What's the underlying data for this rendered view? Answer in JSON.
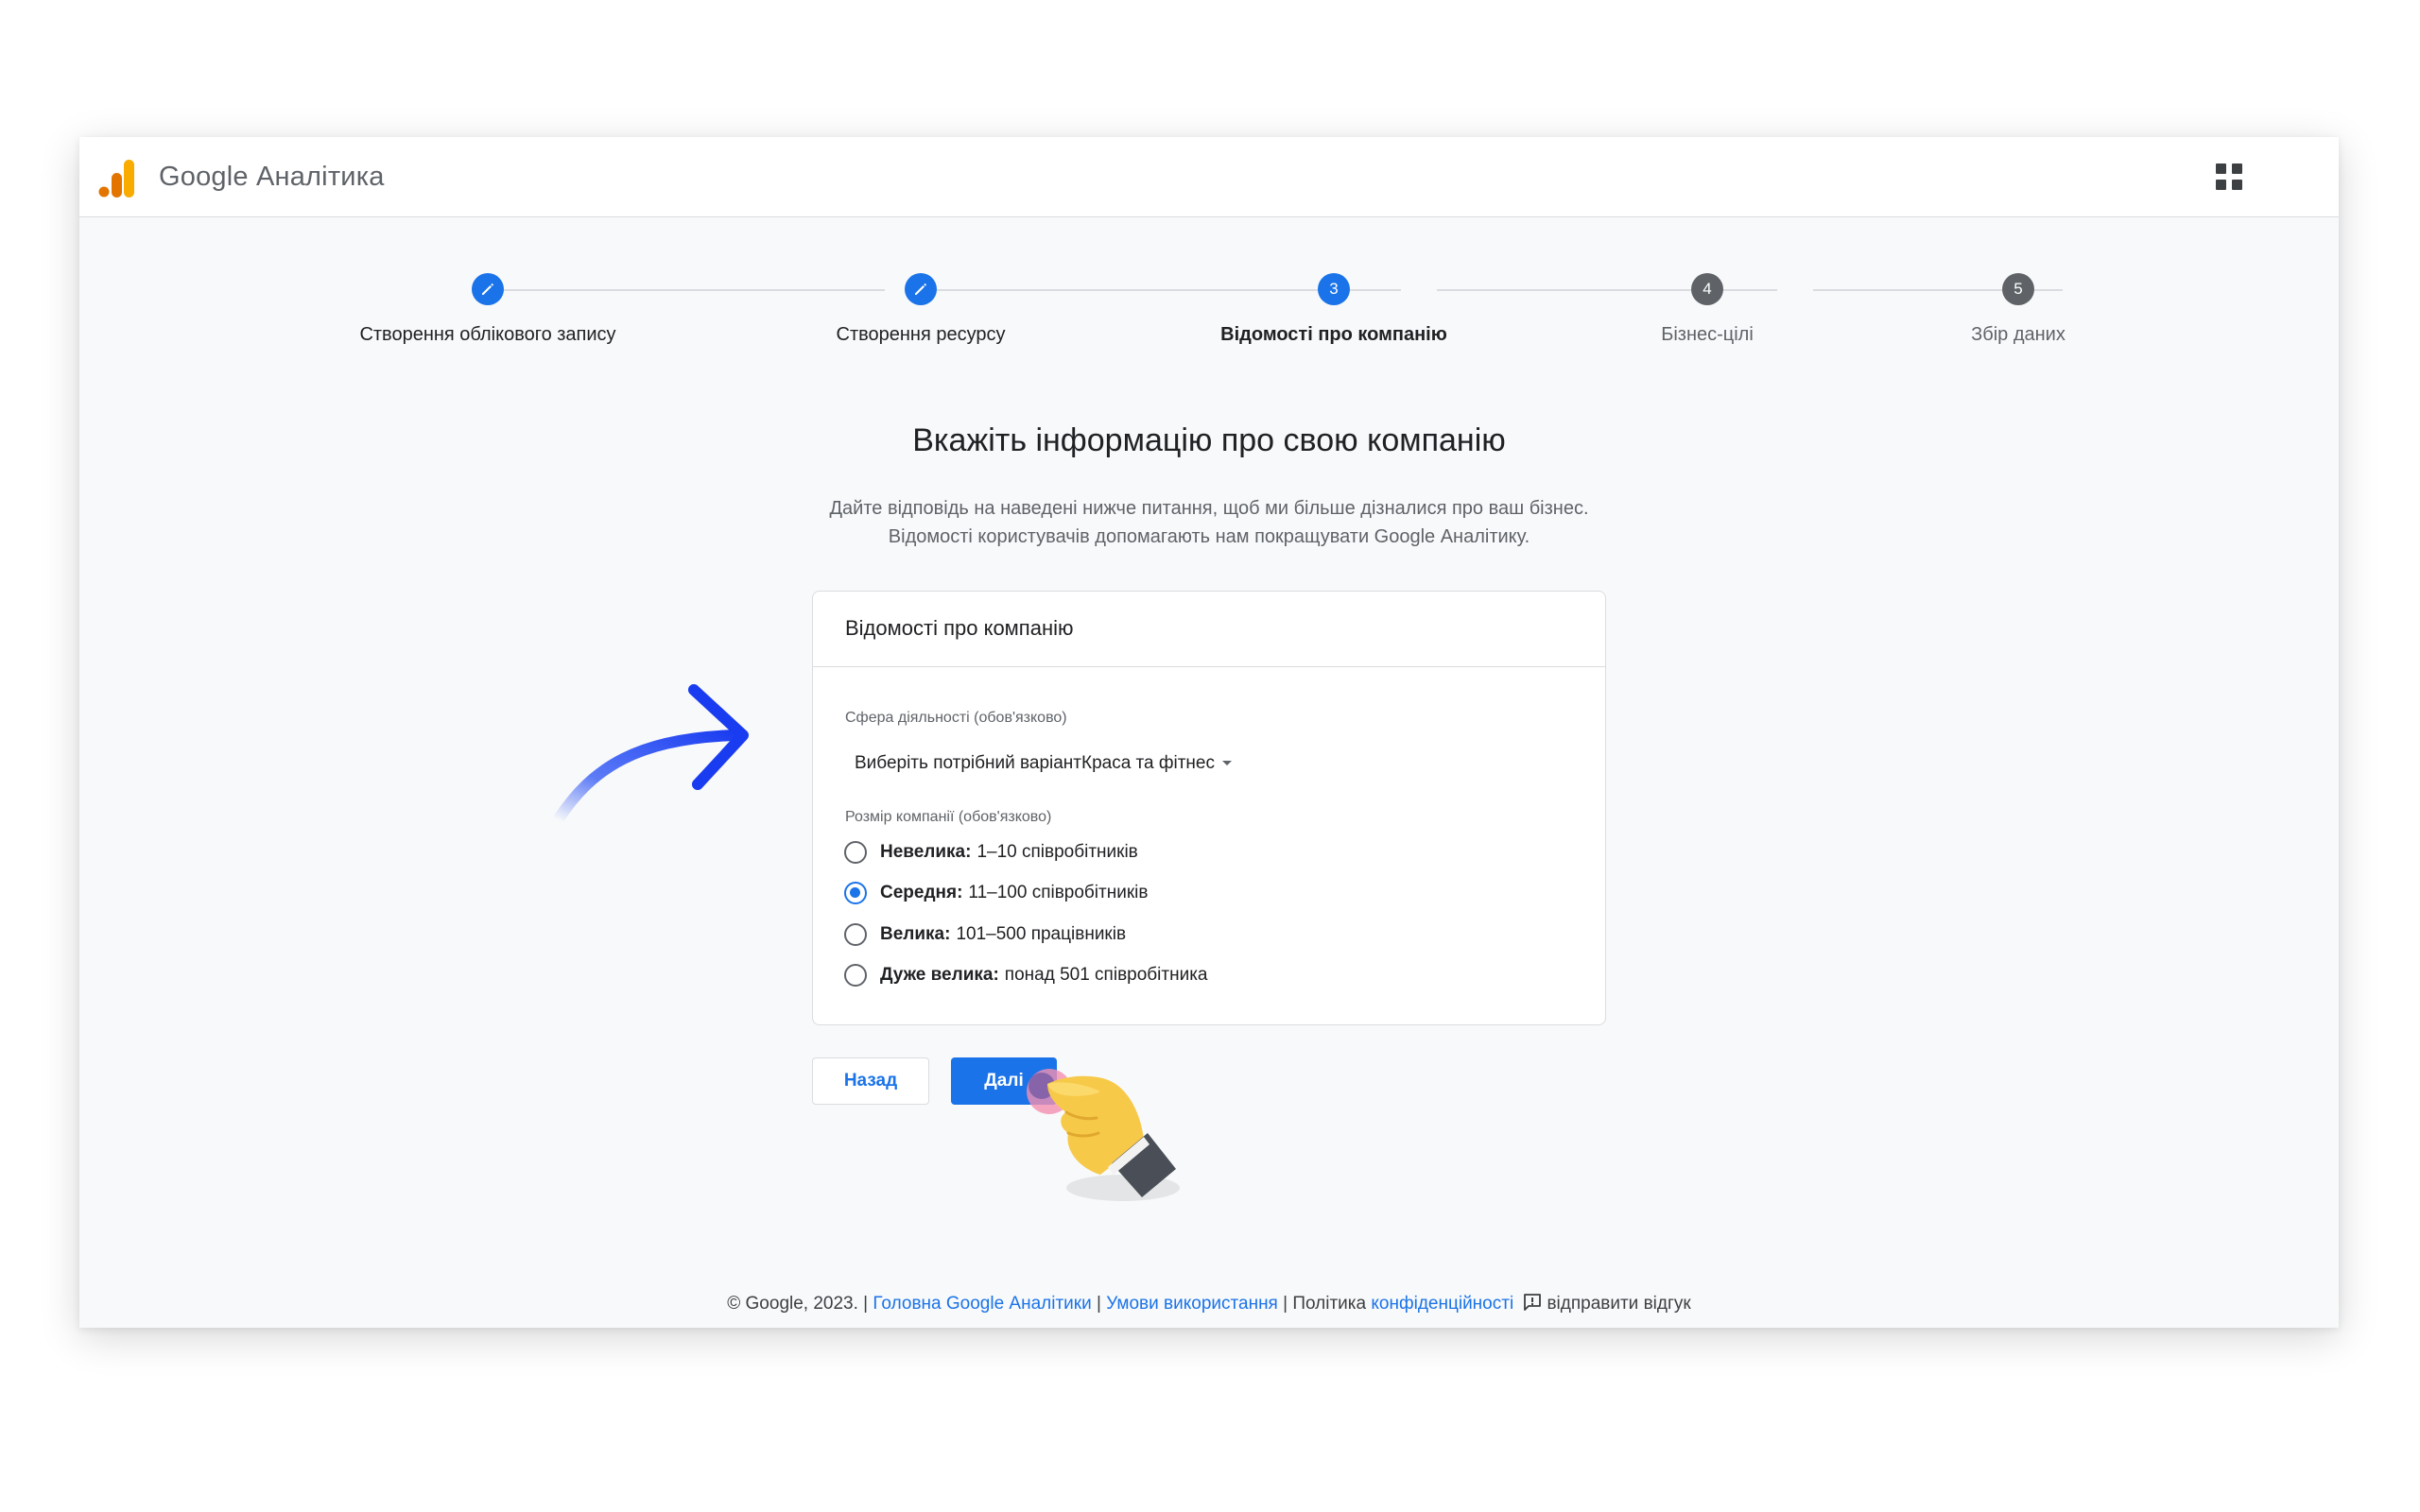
{
  "app": {
    "brand": "Google Аналітика",
    "icons": {
      "logo": "google-analytics-logo-icon",
      "apps": "apps-grid-icon"
    },
    "colors": {
      "accent": "#1a73e8",
      "logo_orange": "#f9ab00",
      "logo_dark_orange": "#e37400"
    }
  },
  "stepper": {
    "steps": [
      {
        "marker": "",
        "label": "Створення облікового запису",
        "state": "done"
      },
      {
        "marker": "",
        "label": "Створення ресурсу",
        "state": "done"
      },
      {
        "marker": "3",
        "label": "Відомості про компанію",
        "state": "active"
      },
      {
        "marker": "4",
        "label": "Бізнес-цілі",
        "state": "todo"
      },
      {
        "marker": "5",
        "label": "Збір даних",
        "state": "todo"
      }
    ]
  },
  "main": {
    "title": "Вкажіть інформацію про свою компанію",
    "subtitle_line1": "Дайте відповідь на наведені нижче питання, щоб ми більше дізналися про ваш бізнес.",
    "subtitle_line2": "Відомості користувачів допомагають нам покращувати Google Аналітику."
  },
  "card": {
    "title": "Відомості про компанію",
    "industry": {
      "label": "Сфера діяльності (обов'язково)",
      "value": "Виберіть потрібний варіантКраса та фітнес"
    },
    "size": {
      "label": "Розмір компанії (обов'язково)",
      "options": [
        {
          "name": "Невелика:",
          "detail": "1–10 співробітників",
          "selected": false
        },
        {
          "name": "Середня:",
          "detail": "11–100 співробітників",
          "selected": true
        },
        {
          "name": "Велика:",
          "detail": "101–500 працівників",
          "selected": false
        },
        {
          "name": "Дуже велика:",
          "detail": "понад 501 співробітника",
          "selected": false
        }
      ]
    }
  },
  "buttons": {
    "back": "Назад",
    "next": "Далі"
  },
  "footer": {
    "copyright": "© Google, 2023. |",
    "home_link": "Головна Google Аналітики",
    "sep1": "|",
    "terms_link": "Умови використання",
    "sep2": "| Політика",
    "privacy_link": "конфіденційності",
    "feedback": "відправити відгук"
  }
}
